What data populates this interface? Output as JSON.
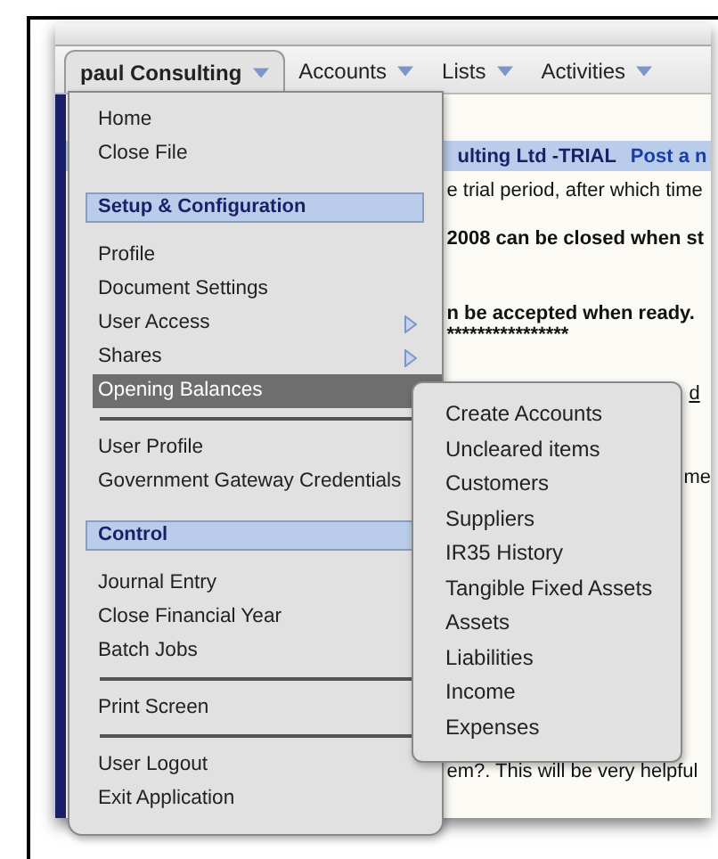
{
  "menu_bar": [
    {
      "label": "paul Consulting",
      "selected": true
    },
    {
      "label": "Accounts",
      "selected": false
    },
    {
      "label": "Lists",
      "selected": false
    },
    {
      "label": "Activities",
      "selected": false
    }
  ],
  "background": {
    "header": "ulting Ltd -TRIAL",
    "header_link": "Post a n",
    "lines": [
      {
        "text": "e trial period, after which time",
        "bold": false
      },
      {
        "text": "2008 can be closed when st",
        "bold": true
      },
      {
        "text": "n be accepted when ready.",
        "bold": true
      },
      {
        "text": "****************",
        "bold": true
      },
      {
        "text": "d",
        "bold": false
      },
      {
        "text": "me",
        "bold": false
      },
      {
        "text": "em?. This will be very helpful",
        "bold": false
      }
    ]
  },
  "menu": [
    {
      "kind": "item",
      "label": "Home",
      "selected": false
    },
    {
      "kind": "item",
      "label": "Close File",
      "selected": false
    },
    {
      "kind": "header",
      "label": "Setup & Configuration"
    },
    {
      "kind": "item",
      "label": "Profile",
      "selected": false
    },
    {
      "kind": "item",
      "label": "Document Settings",
      "selected": false
    },
    {
      "kind": "submenu",
      "label": "User Access",
      "selected": false
    },
    {
      "kind": "submenu",
      "label": "Shares",
      "selected": false
    },
    {
      "kind": "item",
      "label": "Opening Balances",
      "selected": true
    },
    {
      "kind": "separator"
    },
    {
      "kind": "item",
      "label": "User Profile",
      "selected": false
    },
    {
      "kind": "item",
      "label": "Government Gateway Credentials",
      "selected": false
    },
    {
      "kind": "header",
      "label": "Control"
    },
    {
      "kind": "item",
      "label": "Journal Entry",
      "selected": false
    },
    {
      "kind": "item",
      "label": "Close Financial Year",
      "selected": false
    },
    {
      "kind": "item",
      "label": "Batch Jobs",
      "selected": false
    },
    {
      "kind": "separator"
    },
    {
      "kind": "item",
      "label": "Print Screen",
      "selected": false
    },
    {
      "kind": "separator"
    },
    {
      "kind": "item",
      "label": "User Logout",
      "selected": false
    },
    {
      "kind": "item",
      "label": "Exit Application",
      "selected": false
    }
  ],
  "submenu": [
    "Create Accounts",
    "Uncleared items",
    "Customers",
    "Suppliers",
    "IR35 History",
    "Tangible Fixed Assets",
    "Assets",
    "Liabilities",
    "Income",
    "Expenses"
  ]
}
